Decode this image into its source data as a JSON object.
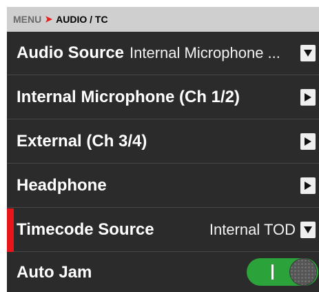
{
  "breadcrumb": {
    "root": "MENU",
    "separator": "➤",
    "current": "AUDIO / TC"
  },
  "rows": [
    {
      "label": "Audio Source",
      "value": "Internal Microphone ...",
      "icon": "chevron-down-icon"
    },
    {
      "label": "Internal Microphone (Ch 1/2)",
      "icon": "chevron-right-icon"
    },
    {
      "label": "External (Ch 3/4)",
      "icon": "chevron-right-icon"
    },
    {
      "label": "Headphone",
      "icon": "chevron-right-icon"
    },
    {
      "label": "Timecode Source",
      "value": "Internal TOD",
      "icon": "chevron-down-icon",
      "selected": true
    },
    {
      "label": "Auto Jam",
      "toggle_on": true
    }
  ],
  "colors": {
    "accent_red": "#e8151b",
    "toggle_green": "#2ba33a",
    "row_bg": "#2b2b2b"
  }
}
